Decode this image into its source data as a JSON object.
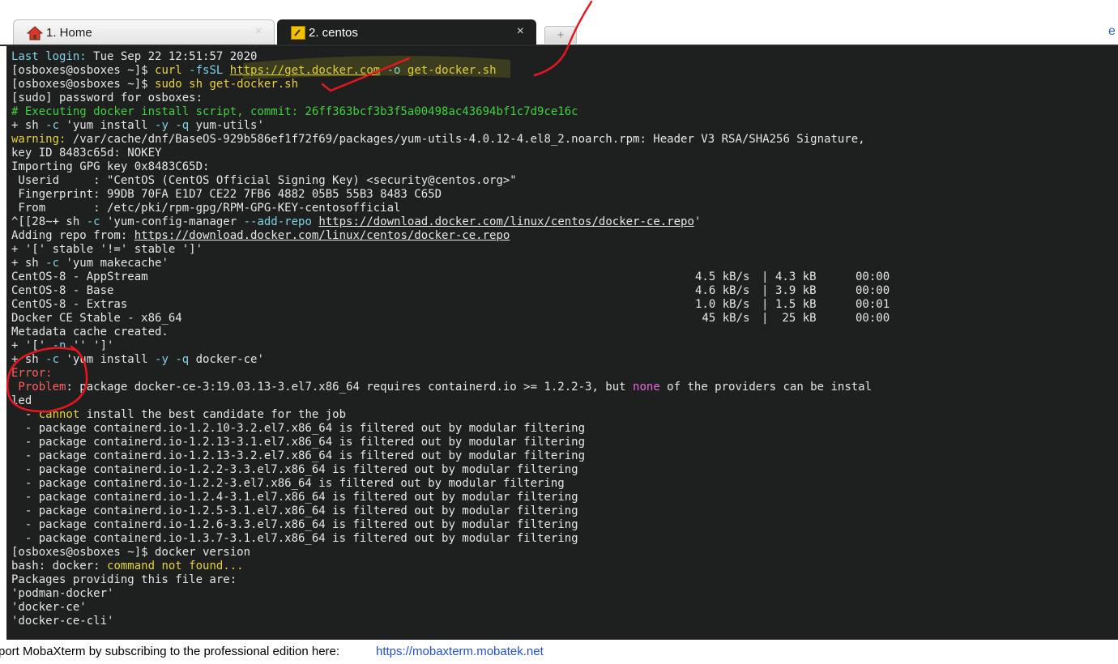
{
  "tabs": [
    {
      "label": "1. Home",
      "icon": "home-icon"
    },
    {
      "label": "2. centos",
      "icon": "terminal-icon"
    }
  ],
  "new_tab_label": "+",
  "terminal": {
    "lines": [
      {
        "t": "",
        "parts": [
          {
            "c": "cyan",
            "t": "Last login: "
          },
          {
            "t": "Tue Sep 22 12:51:57 2020"
          }
        ]
      },
      {
        "parts": [
          {
            "t": "[osboxes@osboxes ~]$ "
          },
          {
            "c": "yellow",
            "t": "curl "
          },
          {
            "c": "cyan",
            "t": "-fsSL "
          },
          {
            "c": "yellow",
            "u": true,
            "t": "https://get.docker.com"
          },
          {
            "t": " "
          },
          {
            "c": "cyan",
            "t": "-o"
          },
          {
            "t": " "
          },
          {
            "c": "yellow",
            "t": "get-docker.sh"
          }
        ]
      },
      {
        "parts": [
          {
            "t": "[osboxes@osboxes ~]$ "
          },
          {
            "c": "yellow",
            "t": "sudo"
          },
          {
            "t": " "
          },
          {
            "c": "yellow",
            "t": "sh get-docker.sh"
          }
        ]
      },
      {
        "parts": [
          {
            "t": "[sudo] password for osboxes:"
          }
        ]
      },
      {
        "parts": [
          {
            "c": "green",
            "t": "# Executing docker install script, commit: 26ff363bcf3b3f5a00498ac43694bf1c7d9ce16c"
          }
        ]
      },
      {
        "parts": [
          {
            "t": "+ sh "
          },
          {
            "c": "cyan",
            "t": "-c"
          },
          {
            "t": " 'yum install "
          },
          {
            "c": "cyan",
            "t": "-y -q"
          },
          {
            "t": " yum-utils'"
          }
        ]
      },
      {
        "parts": [
          {
            "c": "yellow",
            "t": "warning:"
          },
          {
            "t": " /var/cache/dnf/BaseOS-929b586ef1f72f69/packages/yum-utils-4.0.12-4.el8_2.noarch.rpm: Header V3 RSA/SHA256 Signature,"
          }
        ]
      },
      {
        "parts": [
          {
            "t": "key ID 8483c65d: NOKEY"
          }
        ]
      },
      {
        "parts": [
          {
            "t": "Importing GPG key 0x8483C65D:"
          }
        ]
      },
      {
        "parts": [
          {
            "t": " Userid     : \"CentOS (CentOS Official Signing Key) <security@centos.org>\""
          }
        ]
      },
      {
        "parts": [
          {
            "t": " Fingerprint: 99DB 70FA E1D7 CE22 7FB6 4882 05B5 55B3 8483 C65D"
          }
        ]
      },
      {
        "parts": [
          {
            "t": " From       : /etc/pki/rpm-gpg/RPM-GPG-KEY-centosofficial"
          }
        ]
      },
      {
        "parts": [
          {
            "t": "^[[28~+ sh "
          },
          {
            "c": "cyan",
            "t": "-c"
          },
          {
            "t": " 'yum-config-manager "
          },
          {
            "c": "cyan",
            "t": "--add-repo"
          },
          {
            "t": " "
          },
          {
            "u": true,
            "t": "https://download.docker.com/linux/centos/docker-ce.repo"
          },
          {
            "t": "'"
          }
        ]
      },
      {
        "parts": [
          {
            "t": "Adding repo from: "
          },
          {
            "u": true,
            "t": "https://download.docker.com/linux/centos/docker-ce.repo"
          }
        ]
      },
      {
        "parts": [
          {
            "t": "+ '[' stable '!=' stable ']'"
          }
        ]
      },
      {
        "parts": [
          {
            "t": "+ sh "
          },
          {
            "c": "cyan",
            "t": "-c"
          },
          {
            "t": " 'yum makecache'"
          }
        ]
      },
      {
        "parts": [
          {
            "t": "CentOS-8 - AppStream"
          }
        ],
        "stat": {
          "speed": "4.5 kB/s",
          "size": "4.3 kB",
          "time": "00:00"
        }
      },
      {
        "parts": [
          {
            "t": "CentOS-8 - Base"
          }
        ],
        "stat": {
          "speed": "4.6 kB/s",
          "size": "3.9 kB",
          "time": "00:00"
        }
      },
      {
        "parts": [
          {
            "t": "CentOS-8 - Extras"
          }
        ],
        "stat": {
          "speed": "1.0 kB/s",
          "size": "1.5 kB",
          "time": "00:01"
        }
      },
      {
        "parts": [
          {
            "t": "Docker CE Stable - x86_64"
          }
        ],
        "stat": {
          "speed": " 45 kB/s",
          "size": " 25 kB",
          "time": "00:00"
        }
      },
      {
        "parts": [
          {
            "t": "Metadata cache created."
          }
        ]
      },
      {
        "parts": [
          {
            "t": "+ '[' "
          },
          {
            "c": "cyan",
            "t": "-n"
          },
          {
            "t": " '' ']'"
          }
        ]
      },
      {
        "parts": [
          {
            "t": "+ sh "
          },
          {
            "c": "cyan",
            "t": "-c"
          },
          {
            "t": " 'yum install "
          },
          {
            "c": "cyan",
            "t": "-y -q"
          },
          {
            "t": " docker-ce'"
          }
        ]
      },
      {
        "parts": [
          {
            "c": "red",
            "t": "Error:"
          }
        ]
      },
      {
        "parts": [
          {
            "c": "red",
            "t": " Problem"
          },
          {
            "t": ": package docker-ce-3:19.03.13-3.el7.x86_64 requires containerd.io >= 1.2.2-3, but "
          },
          {
            "c": "magenta",
            "t": "none"
          },
          {
            "t": " of the providers can be instal"
          }
        ]
      },
      {
        "parts": [
          {
            "t": "led"
          }
        ]
      },
      {
        "parts": [
          {
            "t": "  - "
          },
          {
            "c": "yellow",
            "t": "cannot"
          },
          {
            "t": " install the best candidate for the job"
          }
        ]
      },
      {
        "parts": [
          {
            "t": "  - package containerd.io-1.2.10-3.2.el7.x86_64 is filtered out by modular filtering"
          }
        ]
      },
      {
        "parts": [
          {
            "t": "  - package containerd.io-1.2.13-3.1.el7.x86_64 is filtered out by modular filtering"
          }
        ]
      },
      {
        "parts": [
          {
            "t": "  - package containerd.io-1.2.13-3.2.el7.x86_64 is filtered out by modular filtering"
          }
        ]
      },
      {
        "parts": [
          {
            "t": "  - package containerd.io-1.2.2-3.3.el7.x86_64 is filtered out by modular filtering"
          }
        ]
      },
      {
        "parts": [
          {
            "t": "  - package containerd.io-1.2.2-3.el7.x86_64 is filtered out by modular filtering"
          }
        ]
      },
      {
        "parts": [
          {
            "t": "  - package containerd.io-1.2.4-3.1.el7.x86_64 is filtered out by modular filtering"
          }
        ]
      },
      {
        "parts": [
          {
            "t": "  - package containerd.io-1.2.5-3.1.el7.x86_64 is filtered out by modular filtering"
          }
        ]
      },
      {
        "parts": [
          {
            "t": "  - package containerd.io-1.2.6-3.3.el7.x86_64 is filtered out by modular filtering"
          }
        ]
      },
      {
        "parts": [
          {
            "t": "  - package containerd.io-1.3.7-3.1.el7.x86_64 is filtered out by modular filtering"
          }
        ]
      },
      {
        "parts": [
          {
            "t": "[osboxes@osboxes ~]$ docker version"
          }
        ]
      },
      {
        "parts": [
          {
            "t": "bash: docker: "
          },
          {
            "c": "yellow",
            "t": "command not found..."
          }
        ]
      },
      {
        "parts": [
          {
            "t": "Packages providing this file are:"
          }
        ]
      },
      {
        "parts": [
          {
            "t": "'podman-docker'"
          }
        ]
      },
      {
        "parts": [
          {
            "t": "'docker-ce'"
          }
        ]
      },
      {
        "parts": [
          {
            "t": "'docker-ce-cli'"
          }
        ]
      }
    ]
  },
  "statusbar": {
    "message": "port MobaXterm by subscribing to the professional edition here:",
    "link": "https://mobaxterm.mobatek.net"
  },
  "colors": {
    "terminal_bg": "#1e1f1f",
    "annotation": "#e8161f"
  }
}
